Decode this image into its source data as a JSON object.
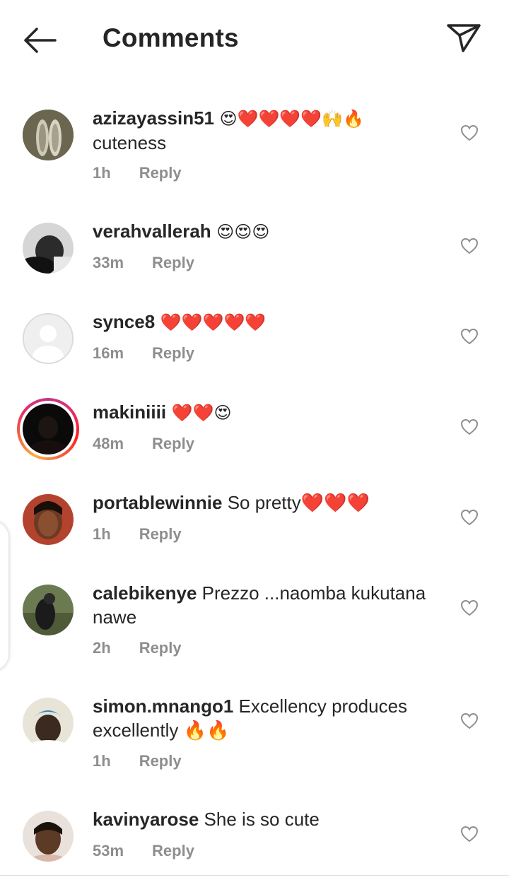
{
  "header": {
    "title": "Comments",
    "back_icon": "arrow-left-icon",
    "send_icon": "paper-plane-icon"
  },
  "colors": {
    "text": "#262626",
    "meta": "#8e8e8e",
    "story_ring": "#e1306c",
    "heart": "#e0245e"
  },
  "comments": [
    {
      "username": "azizayassin51",
      "text": " 😍❤️❤️❤️❤️🙌🔥",
      "text2": "cuteness",
      "time": "1h",
      "reply": "Reply"
    },
    {
      "username": "verahvallerah",
      "text": " 😍😍😍",
      "time": "33m",
      "reply": "Reply"
    },
    {
      "username": "synce8",
      "text": " ❤️❤️❤️❤️❤️",
      "time": "16m",
      "reply": "Reply"
    },
    {
      "username": "makiniiii",
      "text": " ❤️❤️😍",
      "time": "48m",
      "reply": "Reply"
    },
    {
      "username": "portablewinnie",
      "text": " So pretty❤️❤️❤️",
      "time": "1h",
      "reply": "Reply"
    },
    {
      "username": "calebikenye",
      "text": " Prezzo ...naomba kukutana",
      "text2": "nawe",
      "time": "2h",
      "reply": "Reply"
    },
    {
      "username": "simon.mnango1",
      "text": " Excellency produces",
      "text2": "excellently 🔥🔥",
      "time": "1h",
      "reply": "Reply"
    },
    {
      "username": "kavinyarose",
      "text": " She is so cute",
      "time": "53m",
      "reply": "Reply"
    }
  ]
}
